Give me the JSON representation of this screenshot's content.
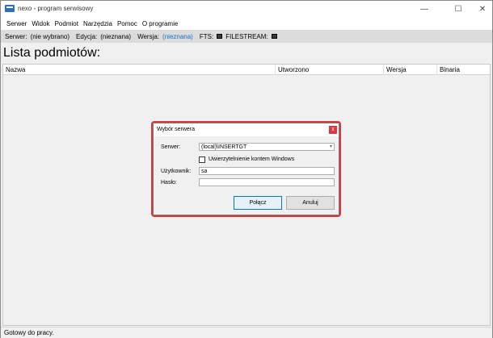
{
  "window": {
    "title": "nexo - program serwisowy",
    "minimize_glyph": "—",
    "maximize_glyph": "☐",
    "close_glyph": "✕"
  },
  "menu": [
    "Serwer",
    "Widok",
    "Podmiot",
    "Narzędzia",
    "Pomoc",
    "O programie"
  ],
  "info": {
    "server_label": "Serwer:",
    "server_value": "(nie wybrano)",
    "edition_label": "Edycja:",
    "edition_value": "(nieznana)",
    "version_label": "Wersja:",
    "version_value": "(nieznana)",
    "fts_label": "FTS:",
    "filestream_label": "FILESTREAM:"
  },
  "page_title": "Lista podmiotów:",
  "table": {
    "columns": [
      "Nazwa",
      "Utworzono",
      "Wersja",
      "Binaria"
    ]
  },
  "status": "Gotowy do pracy.",
  "dialog": {
    "title": "Wybór serwera",
    "close_label": "x",
    "server_label": "Serwer:",
    "server_value": "(local)\\INSERTGT",
    "windows_auth_label": "Uwierzytelnienie kontem Windows",
    "user_label": "Użytkownik:",
    "user_value": "sa",
    "password_label": "Hasło:",
    "password_value": "",
    "connect_button": "Połącz",
    "cancel_button": "Anuluj"
  },
  "colors": {
    "accent": "#0078d7",
    "highlight": "#d9383f",
    "link": "#1a6fc4"
  }
}
